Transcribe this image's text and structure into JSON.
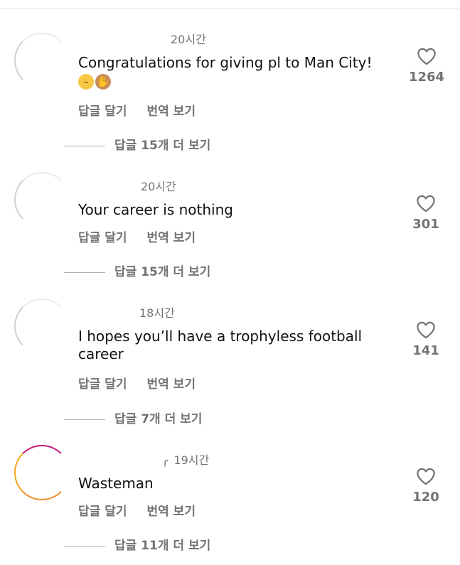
{
  "comments": [
    {
      "timestamp": "20시간",
      "text": "Congratulations for giving pl to Man City!",
      "emojis": [
        "expressionless-face-emoji",
        "clapping-hands-emoji"
      ],
      "reply_label": "답글 달기",
      "translate_label": "번역 보기",
      "view_replies": "답글 15개 더 보기",
      "likes": "1264"
    },
    {
      "timestamp": "20시간",
      "text": "Your career is nothing",
      "reply_label": "답글 달기",
      "translate_label": "번역 보기",
      "view_replies": "답글 15개 더 보기",
      "likes": "301"
    },
    {
      "timestamp": "18시간",
      "text": "I hopes you’ll have a trophyless football career",
      "reply_label": "답글 달기",
      "translate_label": "번역 보기",
      "view_replies": "답글 7개 더 보기",
      "likes": "141"
    },
    {
      "timestamp": "19시간",
      "text": "Wasteman",
      "reply_label": "답글 달기",
      "translate_label": "번역 보기",
      "view_replies": "답글 11개 더 보기",
      "likes": "120"
    }
  ],
  "icons": {
    "like": "heart-outline-icon",
    "pin": "pin-icon"
  },
  "colors": {
    "primary_text": "#111111",
    "secondary_text": "#737373",
    "divider": "#e3e3e3",
    "story_ring_orange": "#f5a623",
    "story_ring_magenta": "#c9197a"
  }
}
